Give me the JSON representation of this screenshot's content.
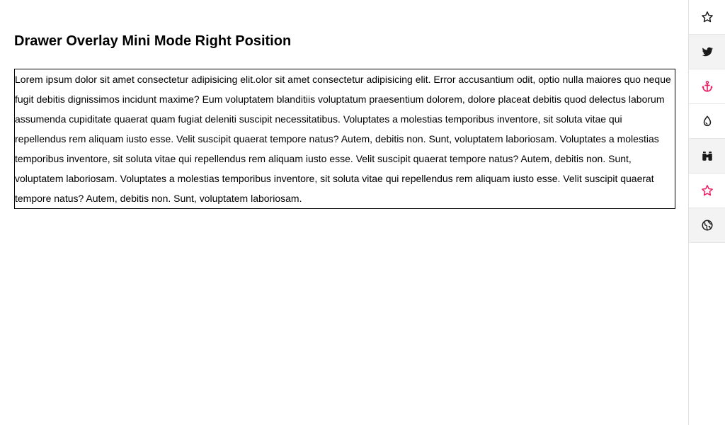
{
  "page": {
    "title": "Drawer Overlay Mini Mode Right Position",
    "body_text": "Lorem ipsum dolor sit amet consectetur adipisicing elit.olor sit amet consectetur adipisicing elit. Error accusantium odit, optio nulla maiores quo neque fugit debitis dignissimos incidunt maxime? Eum voluptatem blanditiis voluptatum praesentium dolorem, dolore placeat debitis quod delectus laborum assumenda cupiditate quaerat quam fugiat deleniti suscipit necessitatibus. Voluptates a molestias temporibus inventore, sit soluta vitae qui repellendus rem aliquam iusto esse. Velit suscipit quaerat tempore natus? Autem, debitis non. Sunt, voluptatem laboriosam. Voluptates a molestias temporibus inventore, sit soluta vitae qui repellendus rem aliquam iusto esse. Velit suscipit quaerat tempore natus? Autem, debitis non. Sunt, voluptatem laboriosam. Voluptates a molestias temporibus inventore, sit soluta vitae qui repellendus rem aliquam iusto esse. Velit suscipit quaerat tempore natus? Autem, debitis non. Sunt, voluptatem laboriosam."
  },
  "drawer": {
    "position": "right",
    "mode": "mini",
    "items": [
      {
        "icon": "star-outline-icon",
        "active": false
      },
      {
        "icon": "twitter-icon",
        "active": false
      },
      {
        "icon": "anchor-icon",
        "active": true
      },
      {
        "icon": "drop-icon",
        "active": false
      },
      {
        "icon": "binoculars-icon",
        "active": false
      },
      {
        "icon": "star-outline-icon",
        "active": true
      },
      {
        "icon": "globe-icon",
        "active": false
      }
    ]
  },
  "colors": {
    "accent": "#e91e63",
    "icon_default": "#1a1a1a",
    "border": "#000000"
  }
}
